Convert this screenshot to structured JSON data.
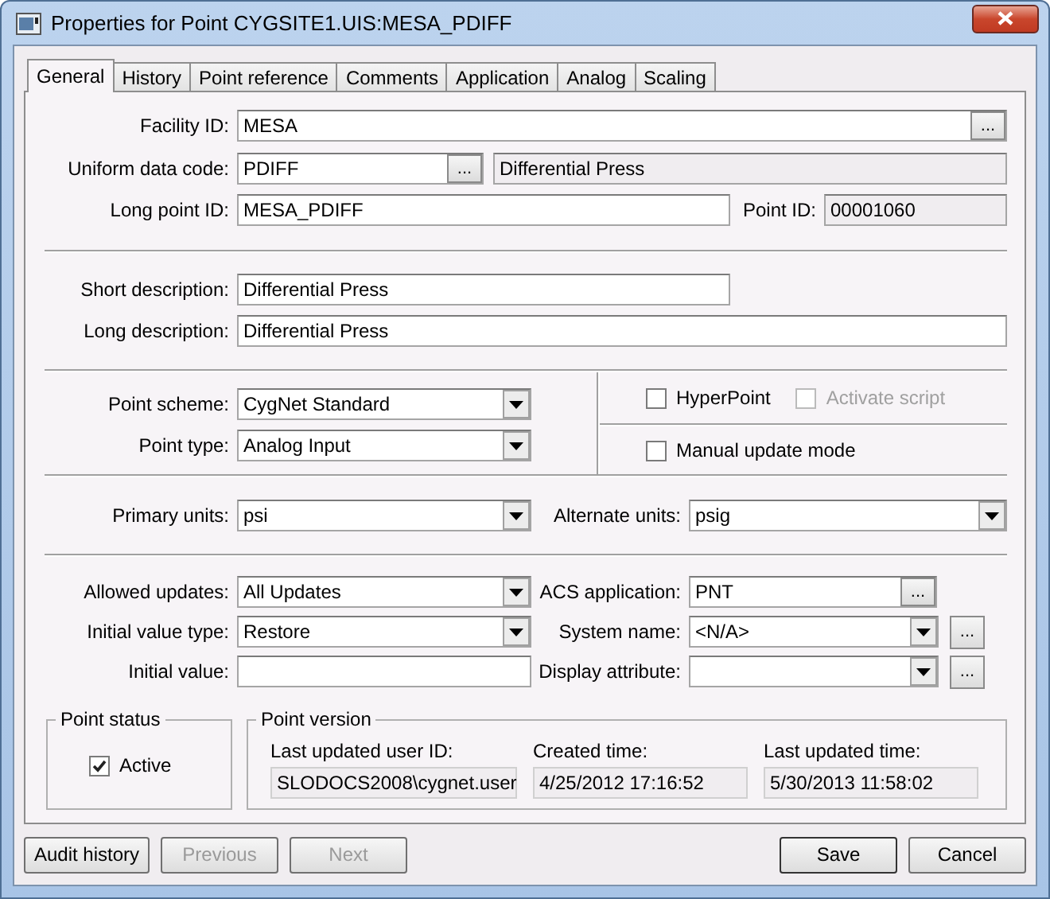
{
  "window": {
    "title": "Properties for Point CYGSITE1.UIS:MESA_PDIFF"
  },
  "tabs": [
    {
      "label": "General",
      "selected": true
    },
    {
      "label": "History",
      "selected": false
    },
    {
      "label": "Point reference",
      "selected": false
    },
    {
      "label": "Comments",
      "selected": false
    },
    {
      "label": "Application",
      "selected": false
    },
    {
      "label": "Analog",
      "selected": false
    },
    {
      "label": "Scaling",
      "selected": false
    }
  ],
  "general": {
    "facility_id": {
      "label": "Facility ID:",
      "value": "MESA",
      "browse_button": "..."
    },
    "uniform_data_code": {
      "label": "Uniform data code:",
      "value": "PDIFF",
      "browse_button": "...",
      "description": "Differential Press",
      "description_readonly": true
    },
    "long_point_id": {
      "label": "Long point ID:",
      "value": "MESA_PDIFF"
    },
    "point_id": {
      "label": "Point ID:",
      "value": "00001060",
      "readonly": true
    },
    "short_description": {
      "label": "Short description:",
      "value": "Differential Press"
    },
    "long_description": {
      "label": "Long description:",
      "value": "Differential Press"
    },
    "point_scheme": {
      "label": "Point scheme:",
      "value": "CygNet Standard"
    },
    "point_type": {
      "label": "Point type:",
      "value": "Analog Input"
    },
    "options": [
      {
        "label": "HyperPoint",
        "checked": false,
        "disabled": false
      },
      {
        "label": "Activate script",
        "checked": false,
        "disabled": true
      },
      {
        "label": "Manual update mode",
        "checked": false,
        "disabled": false
      }
    ],
    "primary_units": {
      "label": "Primary units:",
      "value": "psi"
    },
    "alternate_units": {
      "label": "Alternate units:",
      "value": "psig"
    },
    "allowed_updates": {
      "label": "Allowed updates:",
      "value": "All Updates"
    },
    "acs_application": {
      "label": "ACS application:",
      "value": "PNT",
      "browse_button": "..."
    },
    "initial_value_type": {
      "label": "Initial value type:",
      "value": "Restore"
    },
    "system_name": {
      "label": "System name:",
      "value": "<N/A>",
      "browse_button": "..."
    },
    "initial_value": {
      "label": "Initial value:"
    },
    "display_attribute": {
      "label": "Display attribute:",
      "browse_button": "..."
    },
    "point_status": {
      "title": "Point status",
      "active": {
        "label": "Active",
        "checked": true
      }
    },
    "point_version": {
      "title": "Point version",
      "fields": [
        {
          "label": "Last updated user ID:",
          "value": "SLODOCS2008\\cygnet.user"
        },
        {
          "label": "Created time:",
          "value": "4/25/2012 17:16:52"
        },
        {
          "label": "Last updated time:",
          "value": "5/30/2013 11:58:02"
        }
      ]
    }
  },
  "buttons": [
    {
      "label": "Audit history",
      "disabled": false,
      "default": false
    },
    {
      "label": "Previous",
      "disabled": true,
      "default": false
    },
    {
      "label": "Next",
      "disabled": true,
      "default": false
    },
    {
      "label": "Save",
      "disabled": false,
      "default": true
    },
    {
      "label": "Cancel",
      "disabled": false,
      "default": false
    }
  ]
}
